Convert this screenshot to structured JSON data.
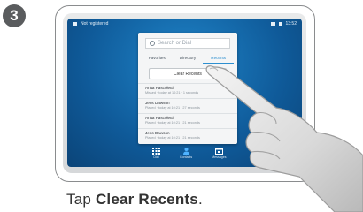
{
  "step": {
    "number": "3"
  },
  "screen": {
    "status": {
      "left": "Not registered",
      "time": "13:52"
    },
    "search_placeholder": "Search or Dial",
    "tabs": [
      {
        "label": "Favorites",
        "active": false
      },
      {
        "label": "Directory",
        "active": false
      },
      {
        "label": "Recents",
        "active": true
      }
    ],
    "clear_recents_label": "Clear Recents",
    "recents": [
      {
        "name": "Anita Pascoletti",
        "detail": "Missed · today at 10:21 · 1 seconds"
      },
      {
        "name": "Jens Dawson",
        "detail": "Placed · today at 10:21 · 27 seconds"
      },
      {
        "name": "Anita Pascoletti",
        "detail": "Placed · today at 10:21 · 21 seconds"
      },
      {
        "name": "Jens Dawson",
        "detail": "Placed · today at 10:21 · 21 seconds"
      }
    ],
    "dock": [
      {
        "label": "Dial",
        "icon": "keypad-icon"
      },
      {
        "label": "Contacts",
        "icon": "person-icon"
      },
      {
        "label": "Messages",
        "icon": "calendar-icon"
      }
    ],
    "colors": {
      "screen_bg": "#1674b8",
      "active_tab": "#2d8fd0"
    }
  },
  "caption": {
    "prefix": "Tap ",
    "bold": "Clear Recents",
    "suffix": "."
  }
}
